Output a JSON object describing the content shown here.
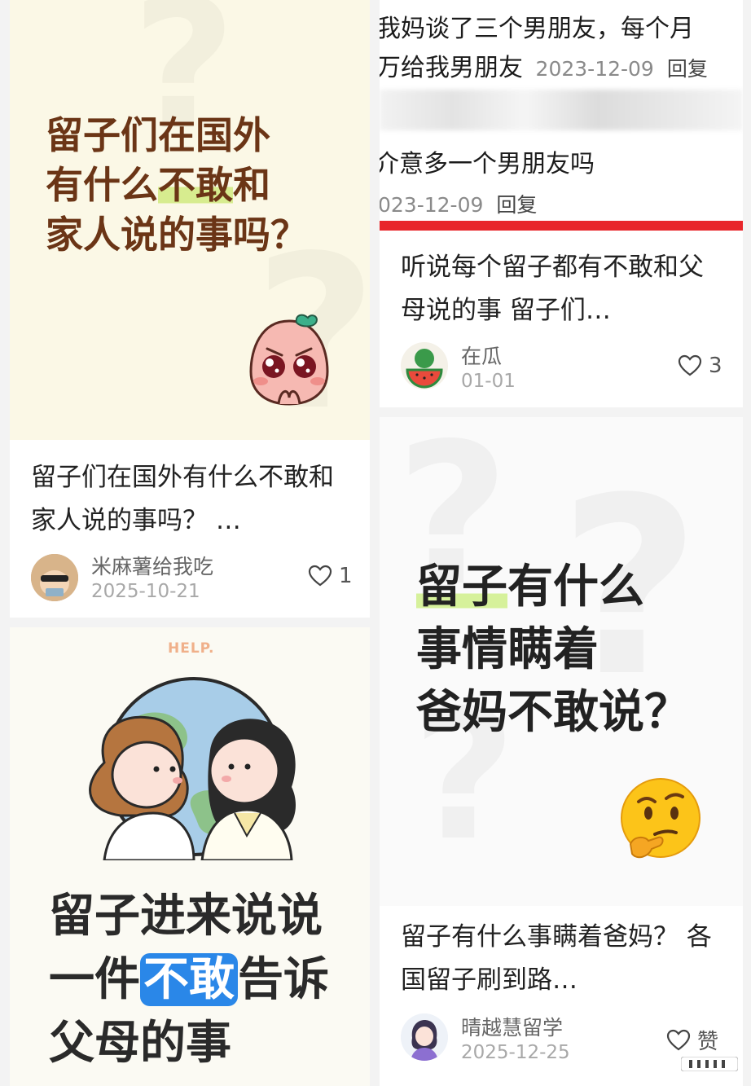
{
  "card1": {
    "cover_line1": "留子们在国外",
    "cover_line2_pre": "有什么",
    "cover_line2_hl": "不敢",
    "cover_line2_post": "和",
    "cover_line3": "家人说的事吗？",
    "title": "留子们在国外有什么不敢和家人说的事吗？ …",
    "author": "米麻薯给我吃",
    "date": "2025-10-21",
    "likes": "1"
  },
  "card2": {
    "comment1_line1": "我妈谈了三个男朋友，每个月",
    "comment1_line2": "万给我男朋友",
    "comment1_date": "2023-12-09",
    "comment1_reply": "回复",
    "comment2_line": "介意多一个男朋友吗",
    "comment2_date": "023-12-09",
    "comment2_reply": "回复",
    "title": "听说每个留子都有不敢和父母说的事 留子们…",
    "author": "在瓜",
    "date": "01-01",
    "likes": "3"
  },
  "card3": {
    "help_text": "HELP.",
    "cover_line1": "留子进来说说",
    "cover_line2_pre": "一件",
    "cover_line2_hl": "不敢",
    "cover_line2_post": "告诉",
    "cover_line3": "父母的事"
  },
  "card4": {
    "cover_line1_hl": "留子",
    "cover_line1_post": "有什么",
    "cover_line2": "事情瞒着",
    "cover_line3": "爸妈不敢说？",
    "title": "留子有什么事瞒着爸妈？ 各国留子刷到路…",
    "author": "晴越慧留学",
    "date": "2025-12-25",
    "likes": "赞"
  },
  "colors": {
    "accent_red": "#e8262b",
    "highlight_blue": "#2a87e8",
    "highlight_green": "#d6f19b",
    "title_brown": "#6b3516"
  }
}
